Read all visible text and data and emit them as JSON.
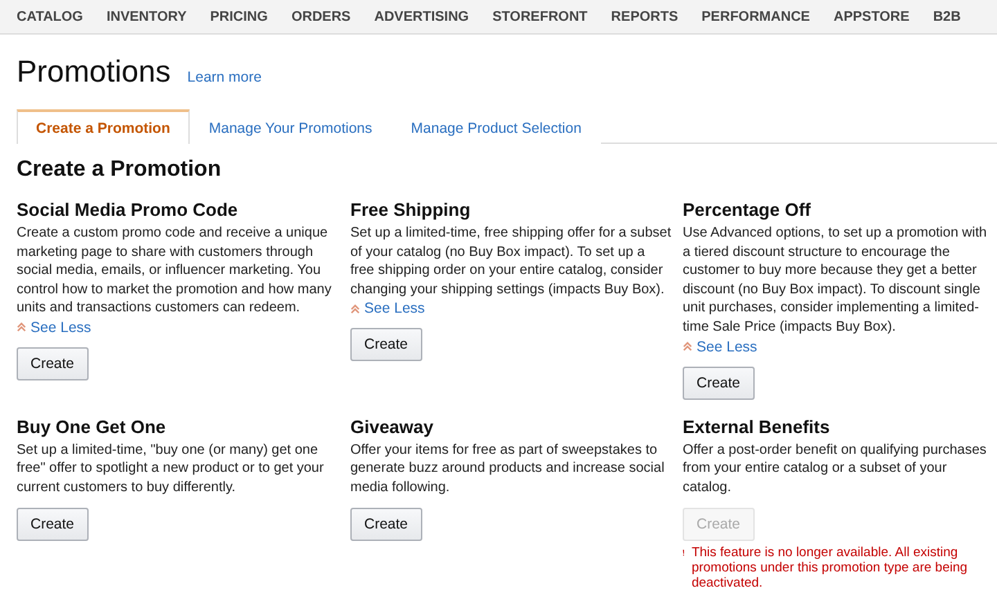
{
  "nav": [
    "CATALOG",
    "INVENTORY",
    "PRICING",
    "ORDERS",
    "ADVERTISING",
    "STOREFRONT",
    "REPORTS",
    "PERFORMANCE",
    "APPSTORE",
    "B2B"
  ],
  "page": {
    "title": "Promotions",
    "learn_more": "Learn more"
  },
  "tabs": [
    {
      "label": "Create a Promotion",
      "selected": true
    },
    {
      "label": "Manage Your Promotions",
      "selected": false
    },
    {
      "label": "Manage Product Selection",
      "selected": false
    }
  ],
  "section_title": "Create a Promotion",
  "promotions": [
    {
      "title": "Social Media Promo Code",
      "description": "Create a custom promo code and receive a unique marketing page to share with customers through social media, emails, or influencer marketing. You control how to market the promotion and how many units and transactions customers can redeem.",
      "see_less": "See Less",
      "button": "Create",
      "disabled": false
    },
    {
      "title": "Free Shipping",
      "description": "Set up a limited-time, free shipping offer for a subset of your catalog (no Buy Box impact). To set up a free shipping order on your entire catalog, consider changing your shipping settings (impacts Buy Box).",
      "see_less": "See Less",
      "button": "Create",
      "disabled": false
    },
    {
      "title": "Percentage Off",
      "description": "Use Advanced options, to set up a promotion with a tiered discount structure to encourage the customer to buy more because they get a better discount (no Buy Box impact). To discount single unit purchases, consider implementing a limited-time Sale Price (impacts Buy Box).",
      "see_less": "See Less",
      "button": "Create",
      "disabled": false
    },
    {
      "title": "Buy One Get One",
      "description": "Set up a limited-time, \"buy one (or many) get one free\" offer to spotlight a new product or to get your current customers to buy differently.",
      "button": "Create",
      "disabled": false
    },
    {
      "title": "Giveaway",
      "description": "Offer your items for free as part of sweepstakes to generate buzz around products and increase social media following.",
      "button": "Create",
      "disabled": false
    },
    {
      "title": "External Benefits",
      "description": "Offer a post-order benefit on qualifying purchases from your entire catalog or a subset of your catalog.",
      "button": "Create",
      "disabled": true,
      "error": "This feature is no longer available. All existing promotions under this promotion type are being deactivated."
    }
  ]
}
